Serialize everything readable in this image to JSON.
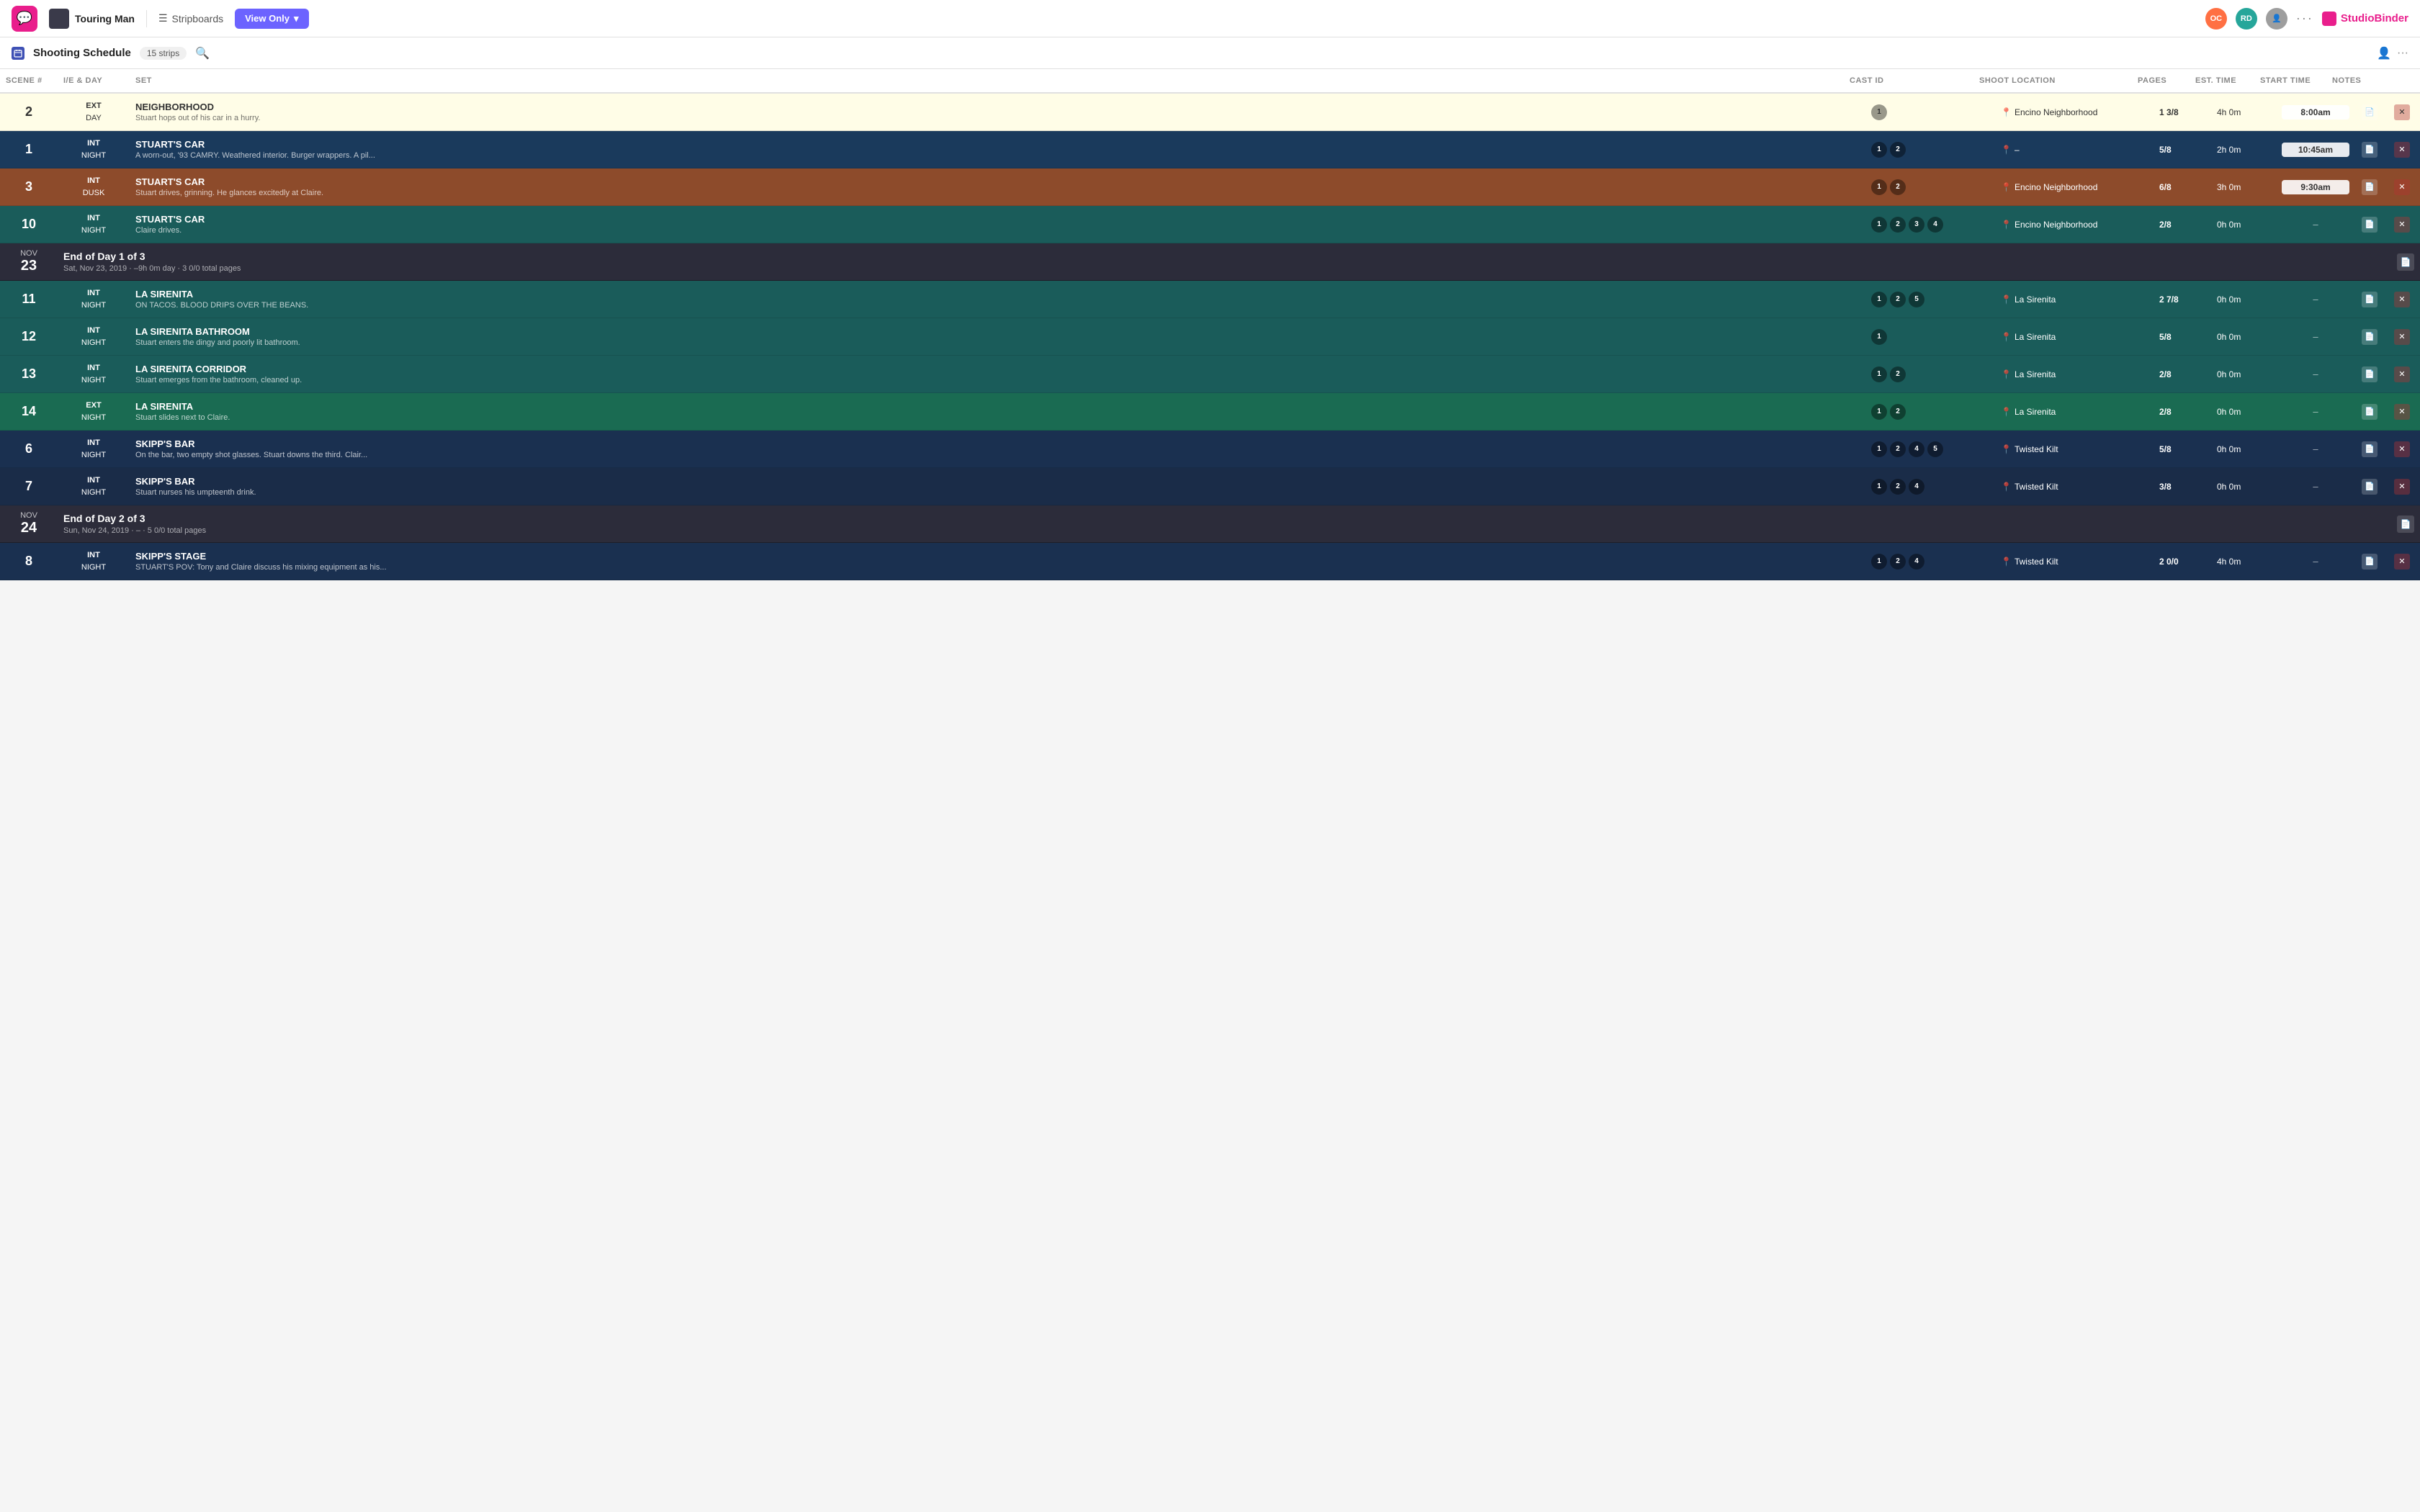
{
  "nav": {
    "app_icon": "💬",
    "project_name": "Touring Man",
    "stripboards_label": "Stripboards",
    "view_only_label": "View Only",
    "dots": "···",
    "studio_binder": "StudioBinder",
    "avatars": [
      {
        "initials": "OC",
        "color": "#ff7043"
      },
      {
        "initials": "RD",
        "color": "#26a69a"
      },
      {
        "initials": "👤",
        "color": "#9e9e9e"
      }
    ]
  },
  "subnav": {
    "title": "Shooting Schedule",
    "strips_count": "15 strips"
  },
  "columns": {
    "scene": "SCENE #",
    "ie_day": "I/E & DAY",
    "set": "SET",
    "cast_id": "CAST ID",
    "shoot_location": "SHOOT LOCATION",
    "pages": "PAGES",
    "est_time": "EST. TIME",
    "start_time": "START TIME",
    "notes": "NOTES"
  },
  "rows": [
    {
      "type": "scene",
      "color": "yellow",
      "scene_num": "2",
      "ie": "EXT",
      "day": "DAY",
      "set_title": "NEIGHBORHOOD",
      "set_desc": "Stuart hops out of his car in a hurry.",
      "cast": [
        "1"
      ],
      "location": "Encino Neighborhood",
      "pages": "1 3/8",
      "est_time": "4h 0m",
      "start_time": "8:00am",
      "has_note": true,
      "has_delete": true
    },
    {
      "type": "scene",
      "color": "blue_dark",
      "scene_num": "1",
      "ie": "INT",
      "day": "NIGHT",
      "set_title": "STUART'S CAR",
      "set_desc": "A worn-out, '93 CAMRY. Weathered interior. Burger wrappers. A pil...",
      "cast": [
        "1",
        "2"
      ],
      "location": "–",
      "pages": "5/8",
      "est_time": "2h 0m",
      "start_time": "10:45am",
      "has_note": true,
      "has_delete": true
    },
    {
      "type": "scene",
      "color": "brown",
      "scene_num": "3",
      "ie": "INT",
      "day": "DUSK",
      "set_title": "STUART'S CAR",
      "set_desc": "Stuart drives, grinning. He glances excitedly at Claire.",
      "cast": [
        "1",
        "2"
      ],
      "location": "Encino Neighborhood",
      "pages": "6/8",
      "est_time": "3h 0m",
      "start_time": "9:30am",
      "has_note": true,
      "has_delete": true
    },
    {
      "type": "scene",
      "color": "teal",
      "scene_num": "10",
      "ie": "INT",
      "day": "NIGHT",
      "set_title": "STUART'S CAR",
      "set_desc": "Claire drives.",
      "cast": [
        "1",
        "2",
        "3",
        "4"
      ],
      "location": "Encino Neighborhood",
      "pages": "2/8",
      "est_time": "0h 0m",
      "start_time": "–",
      "has_note": true,
      "has_delete": true
    },
    {
      "type": "daybreak",
      "date_label": "NOV",
      "date_num": "23",
      "title": "End of Day 1 of 3",
      "subtitle": "Sat, Nov 23, 2019  ·  –9h 0m day  ·  3 0/0 total pages"
    },
    {
      "type": "scene",
      "color": "teal2",
      "scene_num": "11",
      "ie": "INT",
      "day": "NIGHT",
      "set_title": "LA SIRENITA",
      "set_desc": "ON TACOS. BLOOD DRIPS OVER THE BEANS.",
      "cast": [
        "1",
        "2",
        "5"
      ],
      "location": "La Sirenita",
      "pages": "2 7/8",
      "est_time": "0h 0m",
      "start_time": "–",
      "has_note": true,
      "has_delete": true
    },
    {
      "type": "scene",
      "color": "teal2",
      "scene_num": "12",
      "ie": "INT",
      "day": "NIGHT",
      "set_title": "LA SIRENITA BATHROOM",
      "set_desc": "Stuart enters the dingy and poorly lit bathroom.",
      "cast": [
        "1"
      ],
      "location": "La Sirenita",
      "pages": "5/8",
      "est_time": "0h 0m",
      "start_time": "–",
      "has_note": true,
      "has_delete": true
    },
    {
      "type": "scene",
      "color": "teal2",
      "scene_num": "13",
      "ie": "INT",
      "day": "NIGHT",
      "set_title": "LA SIRENITA CORRIDOR",
      "set_desc": "Stuart emerges from the bathroom, cleaned up.",
      "cast": [
        "1",
        "2"
      ],
      "location": "La Sirenita",
      "pages": "2/8",
      "est_time": "0h 0m",
      "start_time": "–",
      "has_note": true,
      "has_delete": true
    },
    {
      "type": "scene",
      "color": "green",
      "scene_num": "14",
      "ie": "EXT",
      "day": "NIGHT",
      "set_title": "LA SIRENITA",
      "set_desc": "Stuart slides next to Claire.",
      "cast": [
        "1",
        "2"
      ],
      "location": "La Sirenita",
      "pages": "2/8",
      "est_time": "0h 0m",
      "start_time": "–",
      "has_note": true,
      "has_delete": true
    },
    {
      "type": "scene",
      "color": "navy",
      "scene_num": "6",
      "ie": "INT",
      "day": "NIGHT",
      "set_title": "SKIPP'S BAR",
      "set_desc": "On the bar, two empty shot glasses. Stuart downs the third. Clair...",
      "cast": [
        "1",
        "2",
        "4",
        "5"
      ],
      "location": "Twisted Kilt",
      "pages": "5/8",
      "est_time": "0h 0m",
      "start_time": "–",
      "has_note": true,
      "has_delete": true
    },
    {
      "type": "scene",
      "color": "navy2",
      "scene_num": "7",
      "ie": "INT",
      "day": "NIGHT",
      "set_title": "SKIPP'S BAR",
      "set_desc": "Stuart nurses his umpteenth drink.",
      "cast": [
        "1",
        "2",
        "4"
      ],
      "location": "Twisted Kilt",
      "pages": "3/8",
      "est_time": "0h 0m",
      "start_time": "–",
      "has_note": true,
      "has_delete": true
    },
    {
      "type": "daybreak",
      "date_label": "NOV",
      "date_num": "24",
      "title": "End of Day 2 of 3",
      "subtitle": "Sun, Nov 24, 2019  ·  –  ·  5 0/0 total pages"
    },
    {
      "type": "scene",
      "color": "navy",
      "scene_num": "8",
      "ie": "INT",
      "day": "NIGHT",
      "set_title": "SKIPP'S STAGE",
      "set_desc": "STUART'S POV: Tony and Claire discuss his mixing equipment as his...",
      "cast": [
        "1",
        "2",
        "4"
      ],
      "location": "Twisted Kilt",
      "pages": "2 0/0",
      "est_time": "4h 0m",
      "start_time": "–",
      "has_note": true,
      "has_delete": true
    }
  ]
}
